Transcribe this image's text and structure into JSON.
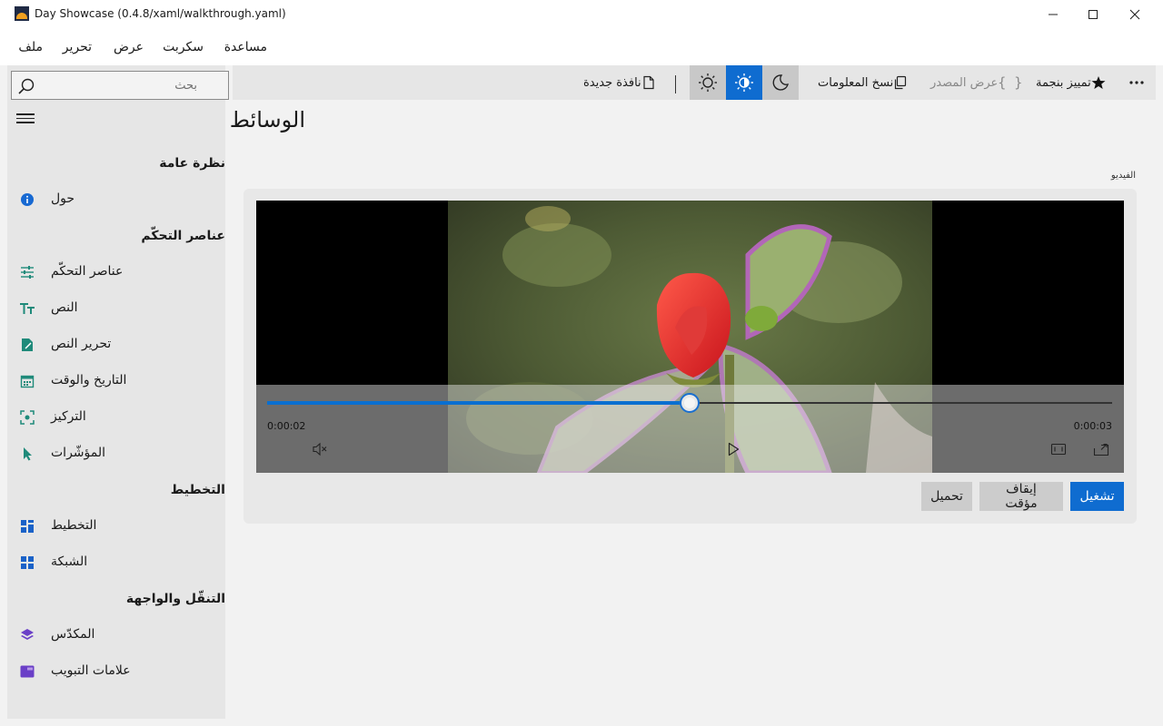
{
  "window": {
    "title": "Day Showcase (0.4.8/xaml/walkthrough.yaml)",
    "controls": [
      "minimize-icon",
      "maximize-icon",
      "close-icon"
    ]
  },
  "menu": {
    "file": "ملف",
    "edit": "تحرير",
    "view": "عرض",
    "script": "سكربت",
    "help": "مساعدة"
  },
  "search": {
    "placeholder": "بحث",
    "value": ""
  },
  "toolbar": {
    "new_window": "نافذة جديدة",
    "copy_info": "نسخ المعلومات",
    "view_source": "عرض المصدر",
    "star": "تمييز بنجمة",
    "theme_modes": [
      "light-theme-icon",
      "auto-theme-icon",
      "dark-theme-icon"
    ],
    "selected_theme": "auto",
    "more": "more-icon"
  },
  "sidebar": {
    "sections": [
      {
        "header": "نظرة عامة",
        "items": [
          {
            "label": "حول",
            "icon": "info-icon"
          }
        ]
      },
      {
        "header": "عناصر التحكّم",
        "items": [
          {
            "label": "عناصر التحكّم",
            "icon": "sliders-icon"
          },
          {
            "label": "النص",
            "icon": "text-icon"
          },
          {
            "label": "تحرير النص",
            "icon": "edit-text-icon"
          },
          {
            "label": "التاريخ والوقت",
            "icon": "calendar-icon"
          },
          {
            "label": "التركيز",
            "icon": "focus-icon"
          },
          {
            "label": "المؤشّرات",
            "icon": "pointer-icon"
          }
        ]
      },
      {
        "header": "التخطيط",
        "items": [
          {
            "label": "التخطيط",
            "icon": "layout-icon"
          },
          {
            "label": "الشبكة",
            "icon": "grid-icon"
          }
        ]
      },
      {
        "header": "التنقّل والواجهة",
        "items": [
          {
            "label": "المكدّس",
            "icon": "stack-icon"
          },
          {
            "label": "علامات التبويب",
            "icon": "tabs-icon"
          }
        ]
      }
    ]
  },
  "page": {
    "title": "الوسائط",
    "section_label": "الفيديو"
  },
  "player": {
    "current_time": "0:00:02",
    "remaining_time": "0:00:03",
    "progress": 0.5,
    "icons": [
      "mute-icon",
      "play-icon",
      "aspect-ratio-icon",
      "cast-icon"
    ]
  },
  "actions": {
    "play": "تشغيل",
    "pause": "إيقاف مؤقت",
    "load": "تحميل"
  },
  "colors": {
    "accent": "#0f6cd0",
    "sidebar_bg": "#e6e6e6",
    "window_bg": "#f2f2f2"
  }
}
